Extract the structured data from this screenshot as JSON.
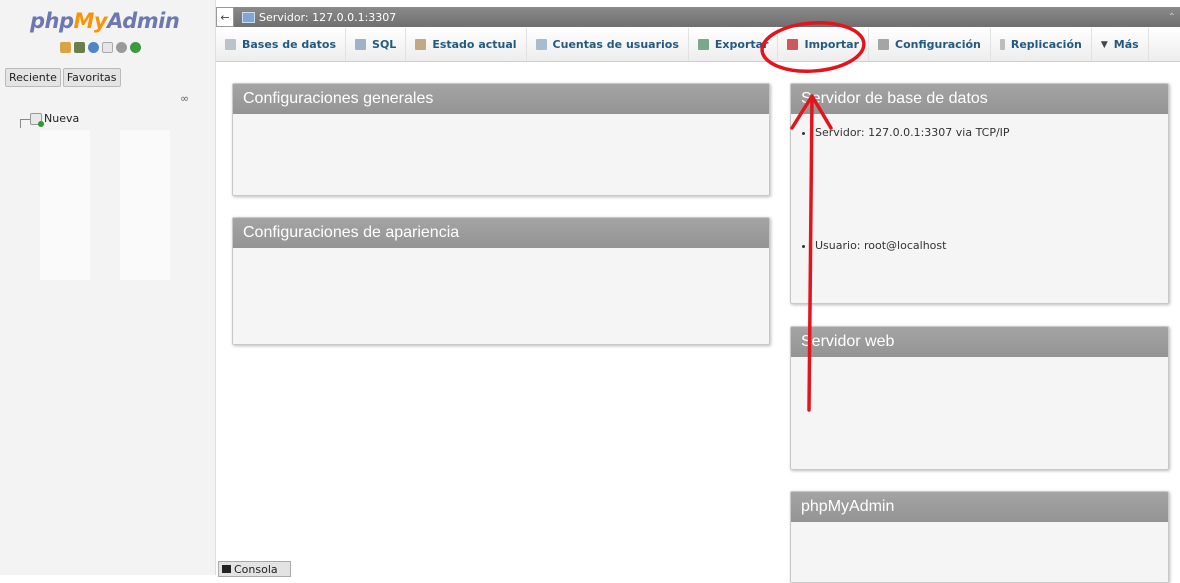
{
  "sidebar": {
    "logo": {
      "php": "php",
      "my": "My",
      "admin": "Admin"
    },
    "tabs": [
      "Reciente",
      "Favoritas"
    ],
    "tree_new": "Nueva",
    "icons": [
      "home-icon",
      "db-icon",
      "help-icon",
      "docs-icon",
      "settings-icon",
      "reload-icon"
    ]
  },
  "server_bar": {
    "collapse_glyph": "←",
    "title": "Servidor: 127.0.0.1:3307"
  },
  "menu": {
    "tabs": [
      {
        "label": "Bases de datos",
        "icon": "databases-icon",
        "color": "#9aa"
      },
      {
        "label": "SQL",
        "icon": "sql-icon",
        "color": "#89a"
      },
      {
        "label": "Estado actual",
        "icon": "status-icon",
        "color": "#a98"
      },
      {
        "label": "Cuentas de usuarios",
        "icon": "users-icon",
        "color": "#8ab"
      },
      {
        "label": "Exportar",
        "icon": "export-icon",
        "color": "#6a8"
      },
      {
        "label": "Importar",
        "icon": "import-icon",
        "color": "#c55"
      },
      {
        "label": "Configuración",
        "icon": "wrench-icon",
        "color": "#999"
      },
      {
        "label": "Replicación",
        "icon": "replication-icon",
        "color": "#aaa"
      },
      {
        "label": "Más",
        "icon": "chevron-down-icon",
        "color": "#555"
      }
    ]
  },
  "panels": {
    "general": {
      "title": "Configuraciones generales"
    },
    "appearance": {
      "title": "Configuraciones de apariencia"
    },
    "db_server": {
      "title": "Servidor de base de datos",
      "items": [
        "Servidor: 127.0.0.1:3307 via TCP/IP",
        "Usuario: root@localhost"
      ]
    },
    "web_server": {
      "title": "Servidor web"
    },
    "pma": {
      "title": "phpMyAdmin"
    }
  },
  "console": {
    "label": "Consola"
  },
  "annotation_color": "#e3141c"
}
